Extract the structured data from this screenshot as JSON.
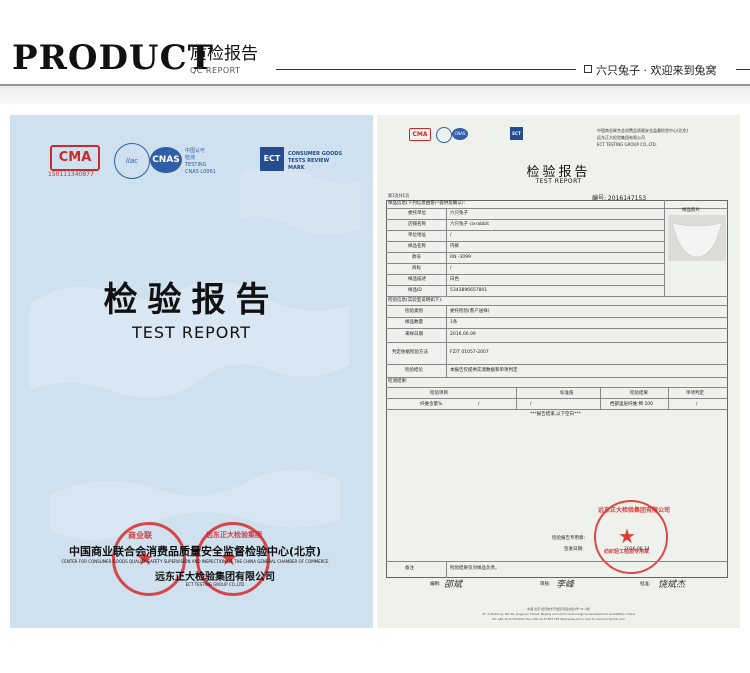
{
  "header": {
    "product": "PRODUCT",
    "title_cn": "质检报告",
    "title_en": "QC REPORT",
    "brand": "六只兔子 · 欢迎来到兔窝"
  },
  "cover": {
    "logo_ma": "CMA",
    "logo_ma_num": "150111340877",
    "logo_ilac": "ilac",
    "logo_cnas": "CNAS",
    "logo_cnas_text": [
      "中国认可",
      "检测",
      "TESTING",
      "CNAS L0061"
    ],
    "logo_ect": "ECT",
    "logo_ect_text": [
      "CONSUMER GOODS",
      "TESTS REVIEW",
      "MARK"
    ],
    "title": "检验报告",
    "subtitle": "TEST REPORT",
    "org_cn": "中国商业联合会消费品质量安全监督检验中心(北京)",
    "org_en": "CENTER FOR CONSUMER GOODS QUALITY SAFETY SUPERVISION AND INSPECTION OF THE CHINA GENERAL CHAMBER OF COMMERCE",
    "org2_cn": "远东正大检验集团有限公司",
    "org2_en": "ECT TESTING GROUP CO.,LTD",
    "stamp1_text": "商业联",
    "stamp2_text": "远东正大检验集团"
  },
  "report": {
    "logo_ma": "CMA",
    "logo_cnas": "CNAS",
    "logo_ect": "ECT",
    "org_lines": [
      "中国商业联合会消费品质量安全监督检验中心(北京)",
      "远东正大检验集团有限公司",
      "ECT TESTING GROUP CO.,LTD."
    ],
    "title": "检验报告",
    "subtitle": "TEST REPORT",
    "page": "第1页共1页",
    "report_no": "编号: 2016147153",
    "sample_info_label": "样品信息(下列信息由客户提供及确认):",
    "photo_label": "样品照片",
    "rows": [
      {
        "label": "委托单位",
        "value": "六只兔子"
      },
      {
        "label": "店铺名称",
        "value": "六只兔子 sixrabbit"
      },
      {
        "label": "单位地址",
        "value": "/"
      },
      {
        "label": "样品名称",
        "value": "内裤"
      },
      {
        "label": "款号",
        "value": "RN -3099"
      },
      {
        "label": "商标",
        "value": "/"
      },
      {
        "label": "样品描述",
        "value": "白色"
      },
      {
        "label": "样品ID",
        "value": "5343896657801"
      }
    ],
    "test_info_label": "检验信息(实验室说明如下):",
    "rows2": [
      {
        "label": "检验类别",
        "value": "委托检验(客户送样)"
      },
      {
        "label": "样品数量",
        "value": "1条"
      },
      {
        "label": "来样日期",
        "value": "2016.06.09"
      },
      {
        "label": "判定依据检验方法",
        "value": "FZ/T 01057-2007"
      },
      {
        "label": "检验结论",
        "value": "本报告仅提供实测数据和单项判定"
      }
    ],
    "result_label": "检测结果:",
    "result_headers": [
      "检验项目",
      "标准值",
      "检验结果",
      "单项判定"
    ],
    "result_row": [
      "纤维含量%",
      "/",
      "/",
      "档部里层纤维:棉 100",
      "/"
    ],
    "blank_text": "***报告结束,以下空白***",
    "stamp_label": "检验报告专用章:",
    "sign_date_label": "签发日期:",
    "sign_date": "2016.06.14",
    "remark_label": "备注",
    "remark_value": "检验结果仅对样品负责。",
    "sign_labels": [
      "编制:",
      "审核:",
      "批准:"
    ],
    "signatures": [
      "邵斌",
      "李峰",
      "饶斌杰"
    ],
    "footer_lines": [
      "中国·北京 经济技术开发区景园北街2号 31-3层",
      "3F, D Building, NO.16, Jingyuan Street, Beijing economic technological development area(BDA), China",
      "Tel:+86-10-67254001  Fax:+86-10-67857728  Web:www.ectcn.com  E-mail:ectc@126.com"
    ],
    "stamp_text": "远东正大检验集团有限公司",
    "stamp_sub": "纺织轻工检验专用章"
  }
}
